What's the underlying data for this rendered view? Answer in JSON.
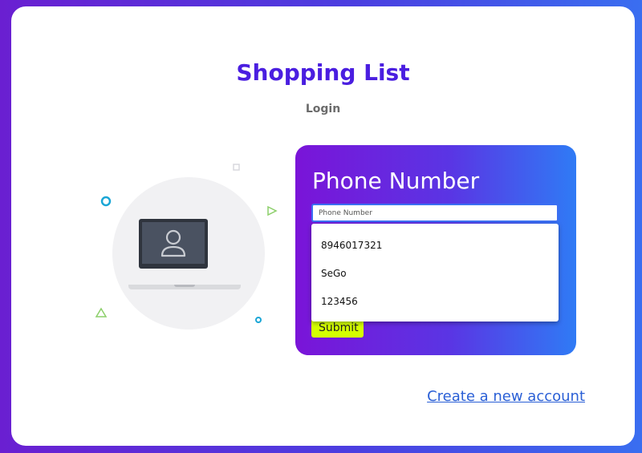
{
  "header": {
    "title": "Shopping List",
    "subtitle": "Login"
  },
  "form": {
    "field_label": "Phone Number",
    "input_placeholder": "Phone Number",
    "input_value": "",
    "autocomplete_options": [
      "8946017321",
      "SeGo",
      "123456"
    ],
    "submit_label": "Submit"
  },
  "footer": {
    "create_account_link": "Create a new account"
  },
  "illustration": {
    "icon": "laptop-user-icon"
  },
  "colors": {
    "title": "#4a1ee0",
    "panel_gradient_start": "#7a14d8",
    "panel_gradient_end": "#2f7bf5",
    "submit_bg": "#d4ff00",
    "link": "#2a5fd6"
  }
}
